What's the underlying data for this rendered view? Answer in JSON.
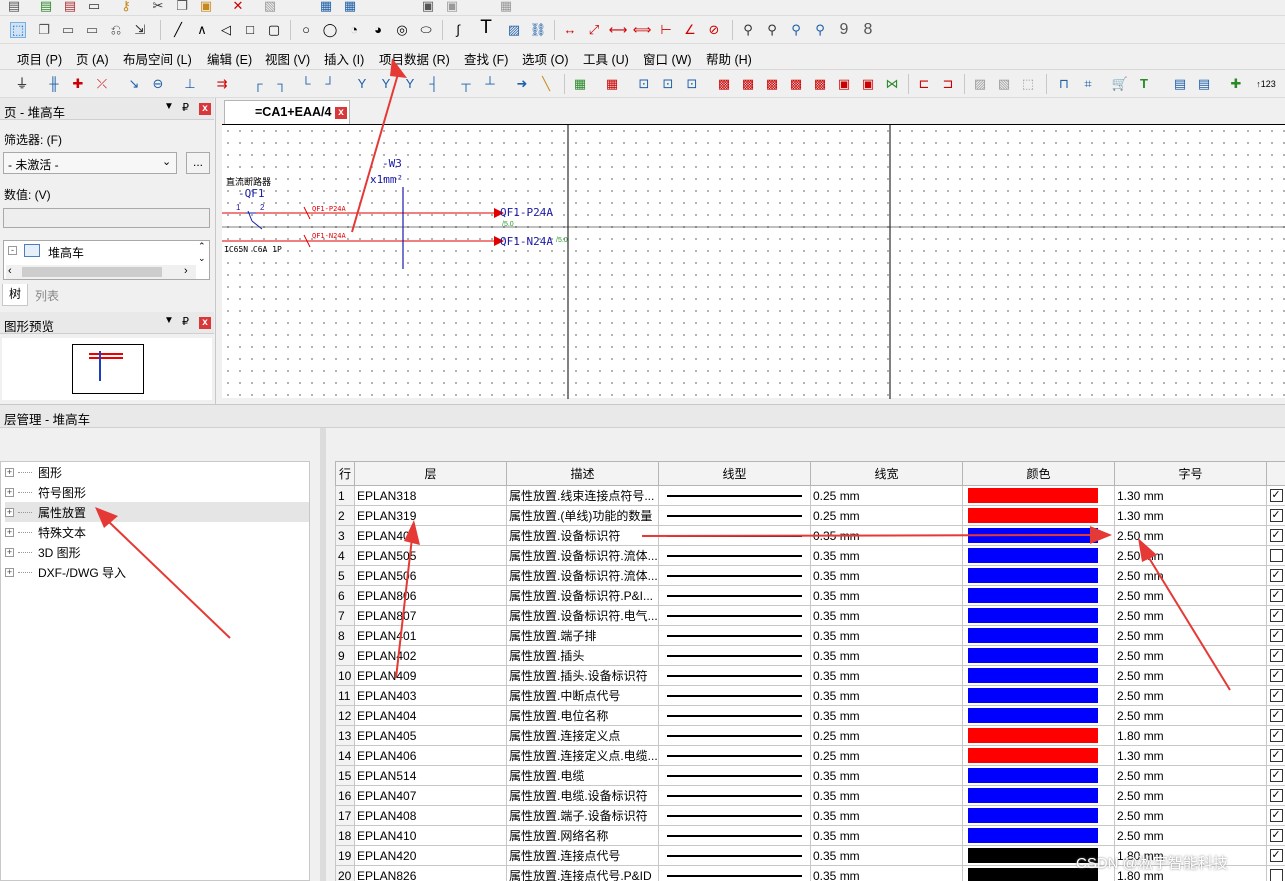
{
  "menu": [
    "项目 (P)",
    "页 (A)",
    "布局空间 (L)",
    "编辑 (E)",
    "视图 (V)",
    "插入 (I)",
    "项目数据 (R)",
    "查找 (F)",
    "选项 (O)",
    "工具 (U)",
    "窗口 (W)",
    "帮助 (H)"
  ],
  "toolbar_icons": [
    "select-icon",
    "copy-page-icon",
    "page-icon",
    "page-icon",
    "undo-page-icon",
    "redo-page-icon",
    "line-icon",
    "polyline-icon",
    "polygon-icon",
    "rectangle-icon",
    "rect-rounded-icon",
    "circle-icon",
    "circle-icon",
    "arc-icon",
    "arc-icon",
    "spiral-icon",
    "ellipse-icon",
    "spline-icon",
    "text-icon",
    "image-icon",
    "hyperlink-icon",
    "dimension-icon",
    "dimension-icon",
    "dimension-icon",
    "dimension-icon",
    "dimension-icon",
    "angle-icon",
    "radius-icon",
    "find-icon",
    "find-icon",
    "find-icon",
    "find-icon"
  ],
  "page_panel": {
    "title": "页 - 堆高车",
    "filter_label": "筛选器: (F)",
    "filter_value": "- 未激活 -",
    "value_label": "数值: (V)",
    "tree_root": "堆高车",
    "tab_tree": "树",
    "tab_list": "列表"
  },
  "preview_panel": {
    "title": "图形预览"
  },
  "drawing_tab": {
    "label": "=CA1+EAA/4"
  },
  "schematic": {
    "breaker_label": "直流断路器",
    "breaker_tag": "-QF1",
    "breaker_spec": "IC65N C6A 1P",
    "pin1": "1",
    "pin2": "2",
    "cable_tag": "-W3",
    "cable_spec": "x1mm²",
    "wire1_label": "QF1-P24A",
    "wire2_label": "QF1-N24A",
    "target1": "QF1-P24A",
    "target2": "QF1-N24A",
    "ref1": "/5.0",
    "ref2": "/5.0"
  },
  "layer_manager": {
    "title": "层管理 - 堆高车",
    "tree": [
      "图形",
      "符号图形",
      "属性放置",
      "特殊文本",
      "3D 图形",
      "DXF-/DWG 导入"
    ],
    "columns": [
      "行",
      "层",
      "描述",
      "线型",
      "线宽",
      "颜色",
      "字号"
    ],
    "rows": [
      {
        "n": "1",
        "layer": "EPLAN318",
        "desc": "属性放置.线束连接点符号...",
        "width": "0.25 mm",
        "color": "#ff0000",
        "size": "1.30 mm",
        "checked": true
      },
      {
        "n": "2",
        "layer": "EPLAN319",
        "desc": "属性放置.(单线)功能的数量",
        "width": "0.25 mm",
        "color": "#ff0000",
        "size": "1.30 mm",
        "checked": true
      },
      {
        "n": "3",
        "layer": "EPLAN400",
        "desc": "属性放置.设备标识符",
        "width": "0.35 mm",
        "color": "#0000ff",
        "size": "2.50 mm",
        "checked": true
      },
      {
        "n": "4",
        "layer": "EPLAN505",
        "desc": "属性放置.设备标识符.流体...",
        "width": "0.35 mm",
        "color": "#0000ff",
        "size": "2.50 mm",
        "checked": false
      },
      {
        "n": "5",
        "layer": "EPLAN506",
        "desc": "属性放置.设备标识符.流体...",
        "width": "0.35 mm",
        "color": "#0000ff",
        "size": "2.50 mm",
        "checked": true
      },
      {
        "n": "6",
        "layer": "EPLAN806",
        "desc": "属性放置.设备标识符.P&I...",
        "width": "0.35 mm",
        "color": "#0000ff",
        "size": "2.50 mm",
        "checked": true
      },
      {
        "n": "7",
        "layer": "EPLAN807",
        "desc": "属性放置.设备标识符.电气...",
        "width": "0.35 mm",
        "color": "#0000ff",
        "size": "2.50 mm",
        "checked": true
      },
      {
        "n": "8",
        "layer": "EPLAN401",
        "desc": "属性放置.端子排",
        "width": "0.35 mm",
        "color": "#0000ff",
        "size": "2.50 mm",
        "checked": true
      },
      {
        "n": "9",
        "layer": "EPLAN402",
        "desc": "属性放置.插头",
        "width": "0.35 mm",
        "color": "#0000ff",
        "size": "2.50 mm",
        "checked": true
      },
      {
        "n": "10",
        "layer": "EPLAN409",
        "desc": "属性放置.插头.设备标识符",
        "width": "0.35 mm",
        "color": "#0000ff",
        "size": "2.50 mm",
        "checked": true
      },
      {
        "n": "11",
        "layer": "EPLAN403",
        "desc": "属性放置.中断点代号",
        "width": "0.35 mm",
        "color": "#0000ff",
        "size": "2.50 mm",
        "checked": true
      },
      {
        "n": "12",
        "layer": "EPLAN404",
        "desc": "属性放置.电位名称",
        "width": "0.35 mm",
        "color": "#0000ff",
        "size": "2.50 mm",
        "checked": true
      },
      {
        "n": "13",
        "layer": "EPLAN405",
        "desc": "属性放置.连接定义点",
        "width": "0.25 mm",
        "color": "#ff0000",
        "size": "1.80 mm",
        "checked": true
      },
      {
        "n": "14",
        "layer": "EPLAN406",
        "desc": "属性放置.连接定义点.电缆...",
        "width": "0.25 mm",
        "color": "#ff0000",
        "size": "1.30 mm",
        "checked": true
      },
      {
        "n": "15",
        "layer": "EPLAN514",
        "desc": "属性放置.电缆",
        "width": "0.35 mm",
        "color": "#0000ff",
        "size": "2.50 mm",
        "checked": true
      },
      {
        "n": "16",
        "layer": "EPLAN407",
        "desc": "属性放置.电缆.设备标识符",
        "width": "0.35 mm",
        "color": "#0000ff",
        "size": "2.50 mm",
        "checked": true
      },
      {
        "n": "17",
        "layer": "EPLAN408",
        "desc": "属性放置.端子.设备标识符",
        "width": "0.35 mm",
        "color": "#0000ff",
        "size": "2.50 mm",
        "checked": true
      },
      {
        "n": "18",
        "layer": "EPLAN410",
        "desc": "属性放置.网络名称",
        "width": "0.35 mm",
        "color": "#0000ff",
        "size": "2.50 mm",
        "checked": true
      },
      {
        "n": "19",
        "layer": "EPLAN420",
        "desc": "属性放置.连接点代号",
        "width": "0.35 mm",
        "color": "#000000",
        "size": "1.80 mm",
        "checked": true
      },
      {
        "n": "20",
        "layer": "EPLAN826",
        "desc": "属性放置.连接点代号.P&ID",
        "width": "0.35 mm",
        "color": "#000000",
        "size": "1.80 mm",
        "checked": false
      }
    ]
  },
  "watermark": "CSDN @淞宇智能科技"
}
